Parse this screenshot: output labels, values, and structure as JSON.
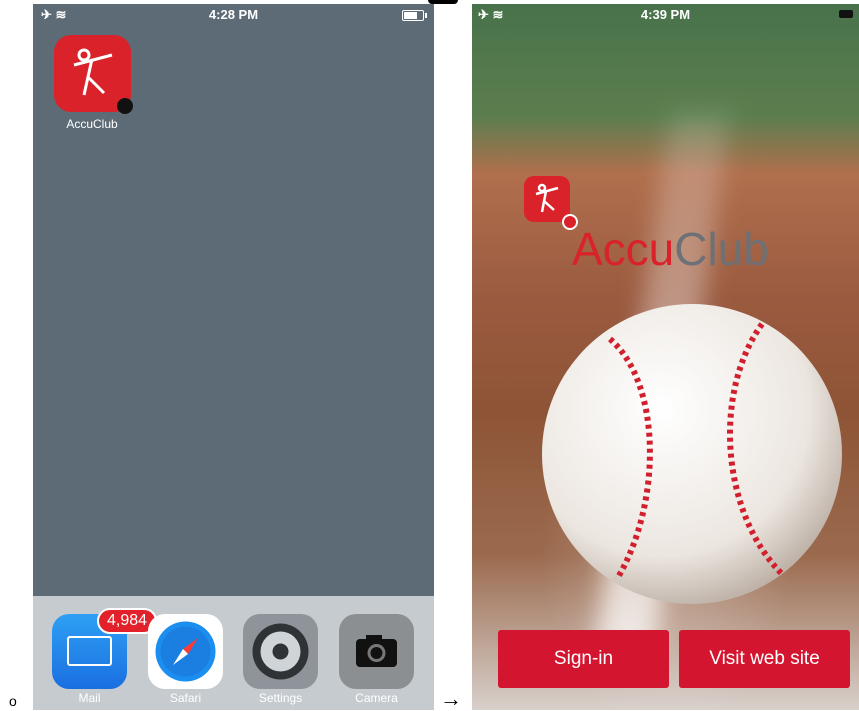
{
  "left_screen": {
    "status": {
      "time": "4:28 PM"
    },
    "app": {
      "label": "AccuClub",
      "icon": "accuclub-app-icon"
    },
    "dock": [
      {
        "label": "Mail",
        "icon": "mail-icon",
        "badge": "4,984"
      },
      {
        "label": "Safari",
        "icon": "safari-icon"
      },
      {
        "label": "Settings",
        "icon": "settings-icon"
      },
      {
        "label": "Camera",
        "icon": "camera-icon"
      }
    ]
  },
  "right_screen": {
    "status": {
      "time": "4:39 PM"
    },
    "logo": {
      "part1": "Accu",
      "part2": "Club"
    },
    "buttons": {
      "signin": "Sign-in",
      "visit": "Visit web site"
    }
  },
  "separators": {
    "bullet": "o",
    "arrow": "→"
  },
  "colors": {
    "brand_red": "#d92229",
    "button_red": "#d4152f",
    "home_bg": "#5d6b76"
  }
}
